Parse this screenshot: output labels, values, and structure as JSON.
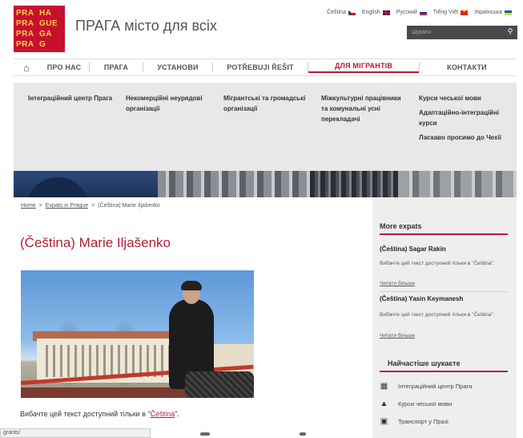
{
  "logo": {
    "cells": [
      "PRA",
      "HA",
      "PRA",
      "GUE",
      "PRA",
      "GA",
      "PRA",
      "G"
    ],
    "colors": {
      "bg": "#c8102e",
      "text": "#f2d04b"
    }
  },
  "site_title": "ПРАГА місто для всіх",
  "languages": [
    {
      "label": "Čeština",
      "flag": "flag-cz"
    },
    {
      "label": "English",
      "flag": "flag-uk"
    },
    {
      "label": "Русский",
      "flag": "flag-ru"
    },
    {
      "label": "Tiếng Việt",
      "flag": "flag-vn"
    },
    {
      "label": "Українська",
      "flag": "flag-ua"
    }
  ],
  "search": {
    "placeholder": "Шукати"
  },
  "nav": {
    "home_icon": "home-icon",
    "items": [
      "ПРО НАС",
      "ПРАГА",
      "УСТАНОВИ",
      "POTŘEBUJI ŘEŠIT",
      "ДЛЯ МІГРАНТІВ",
      "КОНТАКТИ"
    ],
    "active_index": 4
  },
  "dropdown": {
    "col1": [
      "Інтеграційний центр Прага"
    ],
    "col2": [
      "Некомерційні неурядові організації"
    ],
    "col3": [
      "Мігрантські та громадські організації"
    ],
    "col4": [
      "Міжкультурні працівники та комунальні усні перекладачі"
    ],
    "col5": [
      "Курси чеської мови",
      "Адаптаційно-інтеграційні курси",
      "Ласкаво просимо до Чехії"
    ]
  },
  "breadcrumb": {
    "home": "Home",
    "sep1": ">",
    "section": "Expats in Prague",
    "sep2": ">",
    "current": "(Čeština) Marie Iljašenko"
  },
  "page_title": "(Čeština) Marie Iljašenko",
  "notice": {
    "text": "Вибачте цей текст доступний тільки в ",
    "link": "Čeština",
    "end": "\"."
  },
  "status_bar": "grants/",
  "sidebar": {
    "more_expats_title": "More expats",
    "expats": [
      {
        "name": "(Čeština) Sagar Rakin",
        "text": "Вибачте цей текст доступний тільки в \"Čeština\".",
        "link": "Читати більше"
      },
      {
        "name": "(Čeština) Yasin Keymanesh",
        "text": "Вибачте цей текст доступний тільки в \"Čeština\".",
        "link": "Читати більше"
      }
    ],
    "popular_title": "Найчастіше шукаєте",
    "popular": [
      {
        "label": "Інтеграційний центр Прага",
        "icon": "building-icon"
      },
      {
        "label": "Курси чеської мови",
        "icon": "graduation-cap-icon"
      },
      {
        "label": "Транспорт у Празі",
        "icon": "tram-icon"
      }
    ]
  }
}
